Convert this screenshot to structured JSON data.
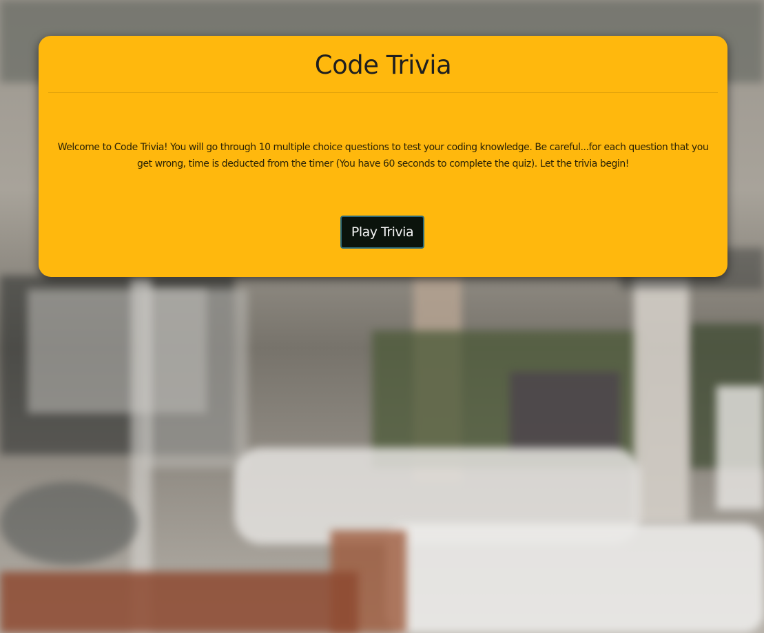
{
  "quiz": {
    "title": "Code Trivia",
    "intro": "Welcome to Code Trivia! You will go through 10 multiple choice questions to test your coding knowledge.  Be careful...for each question that you get wrong, time is deducted from the timer (You have 60 seconds to complete the quiz).  Let the trivia begin!",
    "play_label": "Play Trivia"
  },
  "colors": {
    "card": "#ffb80d",
    "button": "#0b130c",
    "button_text": "#f4f4f4"
  }
}
